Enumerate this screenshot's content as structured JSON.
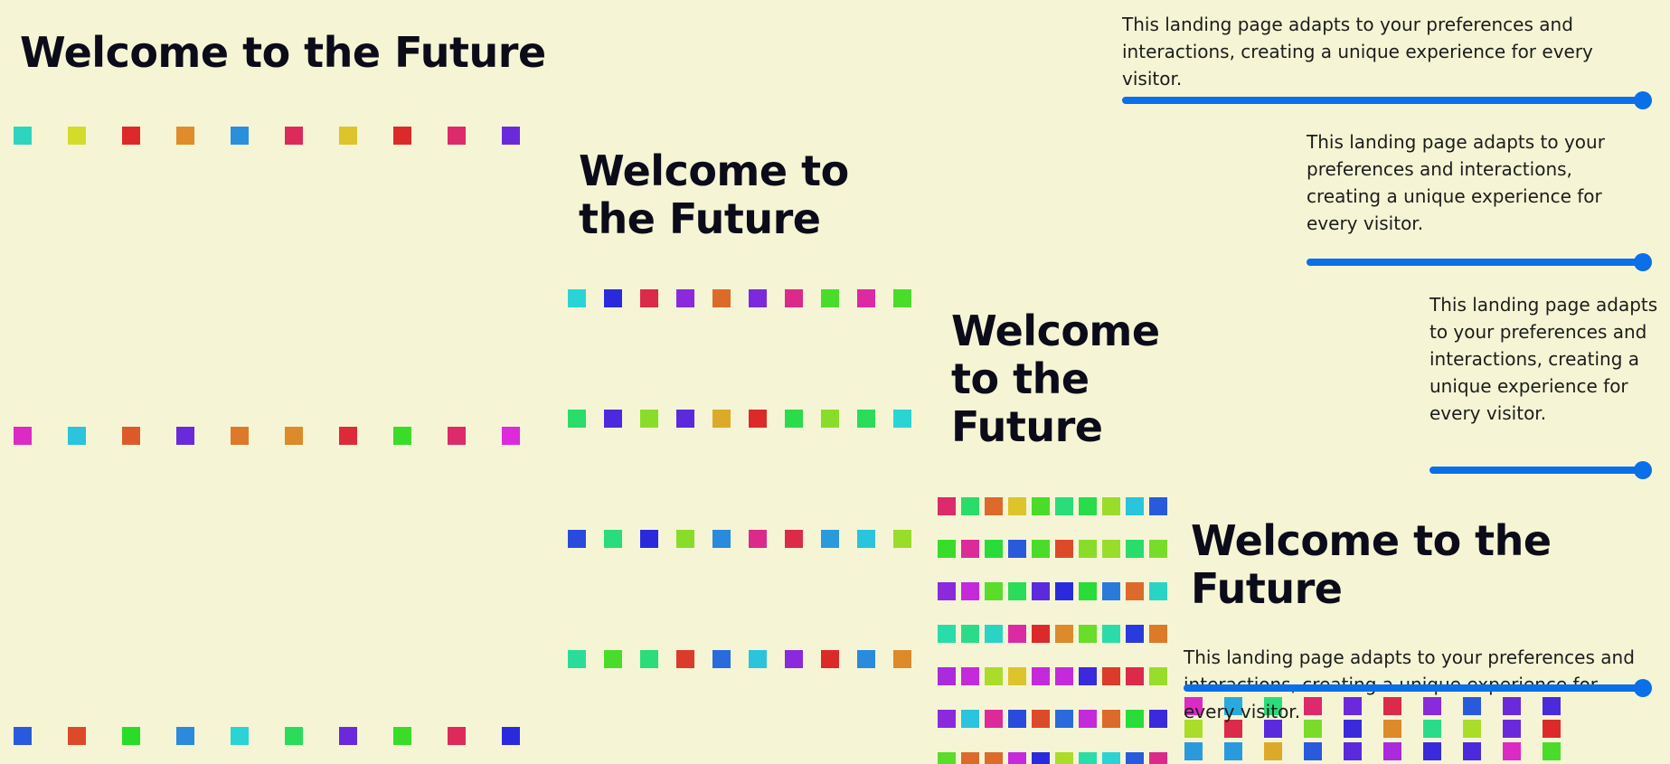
{
  "panels": [
    {
      "title": "Welcome to the Future",
      "description": "This landing page adapts to your preferences and interactions, creating a unique experience for every visitor.",
      "slider_value": 100
    },
    {
      "title": "Welcome to the Future",
      "description": "This landing page adapts to your preferences and interactions, creating a unique experience for every visitor.",
      "slider_value": 100
    },
    {
      "title": "Welcome to the Future",
      "description": "This landing page adapts to your preferences and interactions, creating a unique experience for every visitor.",
      "slider_value": 100
    },
    {
      "title": "Welcome to the Future",
      "description": "This landing page adapts to your preferences and interactions, creating a unique experience for every visitor.",
      "slider_value": 100
    }
  ],
  "accent_color": "#0a6fe8",
  "background_color": "#f5f5d5",
  "tile_grids": [
    {
      "rows": [
        [
          "#2dd4bf",
          "#d4dc2a",
          "#dc2a2a",
          "#e08c2a",
          "#2a90dc",
          "#dc2a5a",
          "#dcc42a",
          "#dc2a2a",
          "#dc2a6a",
          "#6a2adc"
        ],
        [
          "#dc2ac4",
          "#2ac4dc",
          "#dc5a2a",
          "#6a2adc",
          "#dc7a2a",
          "#dc8a2a",
          "#dc2a3a",
          "#3adc2a",
          "#dc2a6a",
          "#dc2adc"
        ],
        [
          "#2a5adc",
          "#dc4a2a",
          "#2adc2a",
          "#2a8adc",
          "#2ad4d4",
          "#2adc5a",
          "#6a2adc",
          "#3adc2a",
          "#dc2a5a",
          "#2a2adc"
        ]
      ]
    },
    {
      "rows": [
        [
          "#2ad4d4",
          "#2a2adc",
          "#dc2a4a",
          "#8a2adc",
          "#dc6a2a",
          "#7a2adc",
          "#dc2a8a",
          "#4adc2a",
          "#dc2aa4",
          "#4adc2a"
        ],
        [
          "#2adc6a",
          "#4a2adc",
          "#8adc2a",
          "#5a2adc",
          "#dcaa2a",
          "#dc2a2a",
          "#2adc4a",
          "#8adc2a",
          "#2adc5a",
          "#2ad4d4"
        ],
        [
          "#2a4adc",
          "#2adc7a",
          "#2a2adc",
          "#8adc2a",
          "#2a8adc",
          "#dc2a8a",
          "#dc2a4a",
          "#2a9adc",
          "#2ac4dc",
          "#9adc2a"
        ],
        [
          "#2adc9a",
          "#4adc2a",
          "#2adc7a",
          "#dc3a2a",
          "#2a6adc",
          "#2ac4dc",
          "#8a2adc",
          "#dc2a2a",
          "#2a8adc",
          "#dc8a2a"
        ]
      ]
    },
    {
      "rows": [
        [
          "#dc2a6a",
          "#2adc6a",
          "#dc6a2a",
          "#dcc42a",
          "#4adc2a",
          "#2adc7a",
          "#2adc4a",
          "#9adc2a",
          "#2ac4dc",
          "#2a5adc"
        ],
        [
          "#3adc2a",
          "#dc2a9a",
          "#2adc3a",
          "#2a5adc",
          "#4adc2a",
          "#dc4a2a",
          "#8adc2a",
          "#9adc2a",
          "#2adc6a",
          "#7adc2a"
        ],
        [
          "#8a2adc",
          "#c42adc",
          "#5adc2a",
          "#2adc5a",
          "#5a2adc",
          "#2a2adc",
          "#2adc3a",
          "#2a7adc",
          "#dc6a2a",
          "#2ad4c4"
        ],
        [
          "#2adcaa",
          "#2adc8a",
          "#2ad4c4",
          "#dc2aa4",
          "#dc2a2a",
          "#dc8a2a",
          "#6adc2a",
          "#2adcaa",
          "#2a3adc",
          "#dc7a2a"
        ],
        [
          "#aa2adc",
          "#c42adc",
          "#aadc2a",
          "#dcc42a",
          "#c42adc",
          "#c42adc",
          "#3a2adc",
          "#dc3a2a",
          "#dc2a4a",
          "#9adc2a"
        ],
        [
          "#8a2adc",
          "#2ac4dc",
          "#dc2a9a",
          "#2a4adc",
          "#dc4a2a",
          "#2a6adc",
          "#c42adc",
          "#dc6a2a",
          "#2adc3a",
          "#3a2adc"
        ],
        [
          "#5adc2a",
          "#dc6a2a",
          "#dc6a2a",
          "#c42adc",
          "#2a2adc",
          "#aadc2a",
          "#2adcaa",
          "#2ad4d4",
          "#2a5adc",
          "#dc2a8a"
        ]
      ]
    },
    {
      "rows": [
        [
          "#dc2ac4",
          "#2aaadc",
          "#2adc7a",
          "#dc2a6a",
          "#6a2adc",
          "#dc2a4a",
          "#8a2adc",
          "#2a5adc",
          "#6a2adc",
          "#4a2adc"
        ],
        [
          "#aadc2a",
          "#dc2a4a",
          "#5a2adc",
          "#7adc2a",
          "#3a2adc",
          "#dc8a2a",
          "#2adc8a",
          "#aadc2a",
          "#6a2adc",
          "#dc2a2a"
        ],
        [
          "#2a9adc",
          "#2a9adc",
          "#dcaa2a",
          "#2a5adc",
          "#5a2adc",
          "#aa2adc",
          "#3a2adc",
          "#4a2adc",
          "#dc2ac4",
          "#4adc2a"
        ]
      ]
    }
  ]
}
